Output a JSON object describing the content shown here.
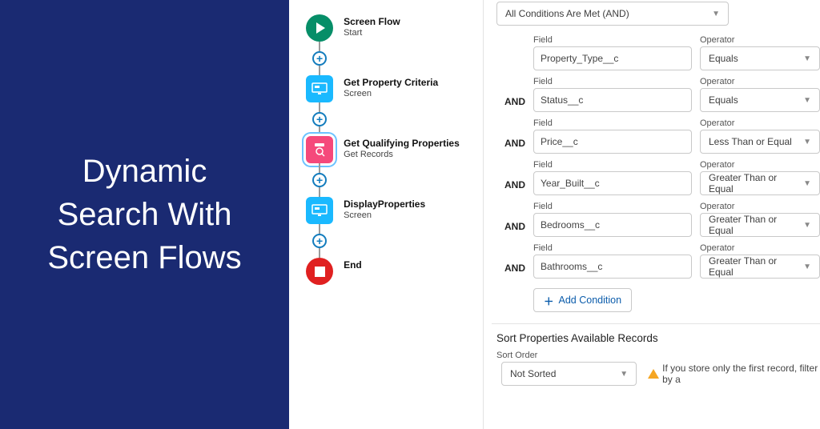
{
  "hero": {
    "title": "Dynamic Search With Screen Flows"
  },
  "flow": {
    "nodes": [
      {
        "title": "Screen Flow",
        "sub": "Start"
      },
      {
        "title": "Get Property Criteria",
        "sub": "Screen"
      },
      {
        "title": "Get Qualifying Properties",
        "sub": "Get Records"
      },
      {
        "title": "DisplayProperties",
        "sub": "Screen"
      },
      {
        "title": "End",
        "sub": ""
      }
    ]
  },
  "panel": {
    "logic_combo": "All Conditions Are Met (AND)",
    "labels": {
      "field": "Field",
      "operator": "Operator",
      "and": "AND"
    },
    "conditions": [
      {
        "field": "Property_Type__c",
        "op": "Equals"
      },
      {
        "field": "Status__c",
        "op": "Equals"
      },
      {
        "field": "Price__c",
        "op": "Less Than or Equal"
      },
      {
        "field": "Year_Built__c",
        "op": "Greater Than or Equal"
      },
      {
        "field": "Bedrooms__c",
        "op": "Greater Than or Equal"
      },
      {
        "field": "Bathrooms__c",
        "op": "Greater Than or Equal"
      }
    ],
    "add_condition": "Add Condition",
    "sort_section_title": "Sort Properties Available Records",
    "sort_order_label": "Sort Order",
    "sort_order_value": "Not Sorted",
    "warning_text": "If you store only the first record, filter by a"
  }
}
